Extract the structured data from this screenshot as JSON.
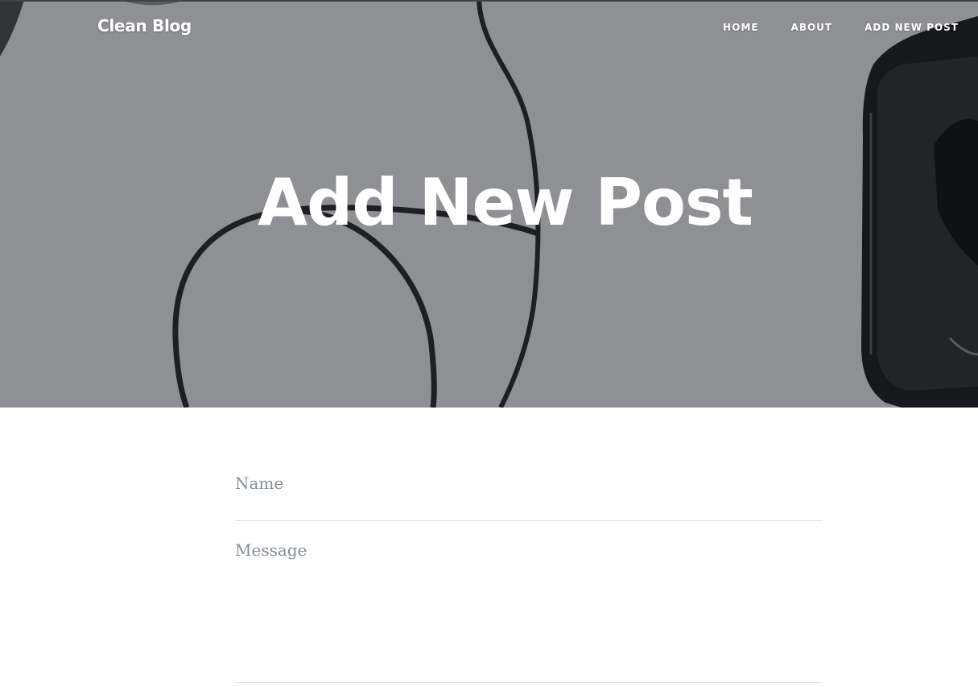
{
  "navbar": {
    "brand": "Clean Blog",
    "links": [
      "HOME",
      "ABOUT",
      "ADD NEW POST"
    ]
  },
  "hero": {
    "heading": "Add New Post"
  },
  "form": {
    "name_placeholder": "Name",
    "message_placeholder": "Message"
  },
  "colors": {
    "hero_overlay": "#8e8f92",
    "text_white": "#ffffff",
    "placeholder": "#868e96",
    "field_border": "#dee2e6"
  }
}
